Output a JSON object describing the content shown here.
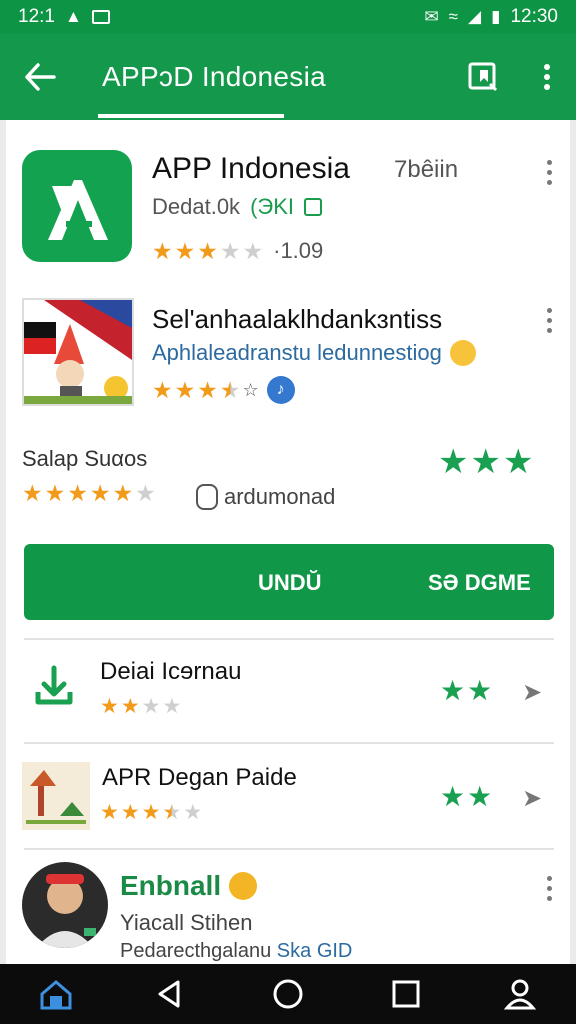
{
  "status_bar": {
    "time_left": "12:1",
    "time_right": "12:30",
    "icons": [
      "notification-icon",
      "image-icon",
      "vibrate-icon",
      "wifi-icon",
      "signal-icon",
      "battery-icon"
    ]
  },
  "toolbar": {
    "title": "APPɔD Indonesia",
    "icons": [
      "back-arrow-icon",
      "bookmark-icon",
      "more-vert-icon"
    ]
  },
  "apps": [
    {
      "title": "APP Indonesia",
      "meta": "7bêiin",
      "subtitle": "Dedat.0k",
      "tag": "(ЭKI",
      "rating_value": "·1.09",
      "rating": 2.5
    },
    {
      "title": "Sel'anhaalaklhdankɜntiss",
      "subtitle": "Aphlaleadranstu ledunnestiog",
      "rating": 3.5
    }
  ],
  "section": {
    "label": "Salap Suαos",
    "related": "ardumonad",
    "rating": 5,
    "green_stars": "★★★"
  },
  "cta": {
    "left_label": "UNDŬ",
    "right_label": "SƏ DGME"
  },
  "list": [
    {
      "title": "Deiai Icɘrnau",
      "rating": 2,
      "icon": "download-icon"
    },
    {
      "title": "APR Degan Paide",
      "rating": 3,
      "icon": "tent-icon"
    }
  ],
  "recommendation": {
    "title": "Enbnall",
    "line1": "Yiacall Stihen",
    "line2_prefix": "Pedarecthgalanu",
    "line2_accent": "Ska GID"
  },
  "colors": {
    "primary": "#14984b",
    "star": "#f29b1b",
    "link": "#2d6aa0"
  }
}
